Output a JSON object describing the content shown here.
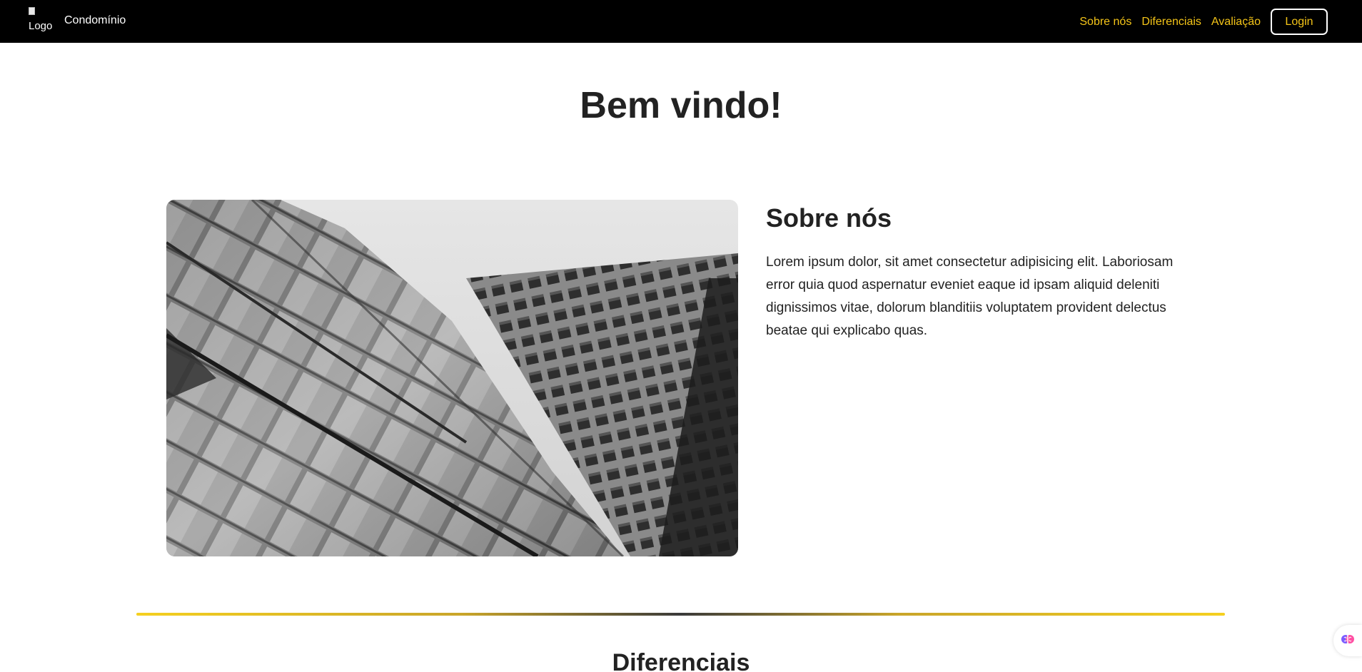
{
  "navbar": {
    "logo_alt": "Logo",
    "brand_name": "Condomínio",
    "links": [
      "Sobre nós",
      "Diferenciais",
      "Avaliação"
    ],
    "login_label": "Login",
    "link_color": "#f5c518",
    "background": "#000000"
  },
  "hero": {
    "title": "Bem vindo!"
  },
  "about": {
    "image": "building-photo",
    "title": "Sobre nós",
    "text": "Lorem ipsum dolor, sit amet consectetur adipisicing elit. Laboriosam error quia quod aspernatur eveniet eaque id ipsam aliquid deleniti dignissimos vitae, dolorum blanditiis voluptatem provident delectus beatae qui explicabo quas."
  },
  "features": {
    "title": "Diferenciais"
  },
  "widget": {
    "icon": "brain-icon"
  }
}
